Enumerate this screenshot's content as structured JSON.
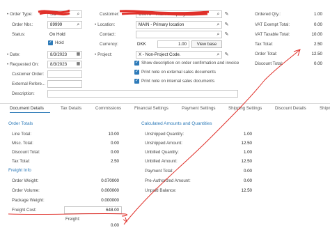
{
  "header": {
    "order_type": {
      "label": "Order Type:",
      "value": "SO"
    },
    "order_nbr": {
      "label": "Order Nbr.:",
      "value": "89999"
    },
    "status": {
      "label": "Status:",
      "value": "On Hold"
    },
    "hold": {
      "label": "Hold",
      "checked": true
    },
    "date": {
      "label": "Date:",
      "value": "8/3/2023"
    },
    "requested_on": {
      "label": "Requested On:",
      "value": "8/3/2023"
    },
    "customer_order": {
      "label": "Customer Order:",
      "value": ""
    },
    "external_ref": {
      "label": "External Refere...",
      "value": ""
    },
    "description": {
      "label": "Description:",
      "value": ""
    },
    "customer": {
      "label": "Customer:",
      "value": "C0076 - Thain Company"
    },
    "location": {
      "label": "Location:",
      "value": "MAIN - Primary location"
    },
    "contact": {
      "label": "Contact:",
      "value": ""
    },
    "currency": {
      "label": "Currency:",
      "code": "DKK",
      "rate": "1.00",
      "view_base_label": "View base"
    },
    "project": {
      "label": "Project:",
      "value": "X - Non-Project Code."
    },
    "options": [
      {
        "label": "Show description on order confirmation and invoice",
        "checked": true
      },
      {
        "label": "Print note on external sales documents",
        "checked": true
      },
      {
        "label": "Print note on internal sales documents",
        "checked": true
      }
    ]
  },
  "summary": [
    {
      "label": "Ordered Qty.:",
      "value": "1.00"
    },
    {
      "label": "VAT Exempt Total:",
      "value": "0.00"
    },
    {
      "label": "VAT Taxable Total:",
      "value": "10.00"
    },
    {
      "label": "Tax Total:",
      "value": "2.50"
    },
    {
      "label": "Order Total:",
      "value": "12.50"
    },
    {
      "label": "Discount Total:",
      "value": "0.00"
    }
  ],
  "tabs": [
    "Document Details",
    "Tax Details",
    "Commissions",
    "Financial Settings",
    "Payment Settings",
    "Shipping Settings",
    "Discount Details",
    "Shipm"
  ],
  "order_totals": {
    "title": "Order Totals",
    "rows": [
      {
        "label": "Line Total:",
        "value": "10.00"
      },
      {
        "label": "Misc. Total:",
        "value": "0.00"
      },
      {
        "label": "Discount Total:",
        "value": "0.00"
      },
      {
        "label": "Tax Total:",
        "value": "2.50"
      }
    ]
  },
  "freight_info": {
    "title": "Freight Info",
    "rows": [
      {
        "label": "Order Weight:",
        "value": "0.070000"
      },
      {
        "label": "Order Volume:",
        "value": "0.000000"
      },
      {
        "label": "Package Weight:",
        "value": "0.000000"
      },
      {
        "label": "Freight Cost:",
        "value": "648.00"
      },
      {
        "label": "Freight:",
        "value": "0.00"
      }
    ]
  },
  "calculated": {
    "title": "Calculated Amounts and Quantities",
    "rows": [
      {
        "label": "Unshipped Quantity:",
        "value": "1.00"
      },
      {
        "label": "Unshipped Amount:",
        "value": "12.50"
      },
      {
        "label": "Unbilled Quantity:",
        "value": "1.00"
      },
      {
        "label": "Unbilled Amount:",
        "value": "12.50"
      },
      {
        "label": "Payment Total:",
        "value": "0.00"
      },
      {
        "label": "Pre-Authorized Amount:",
        "value": "0.00"
      },
      {
        "label": "Unpaid Balance:",
        "value": "12.50"
      }
    ]
  },
  "colors": {
    "accent": "#2d7ab8",
    "annotation": "#e0302a"
  }
}
